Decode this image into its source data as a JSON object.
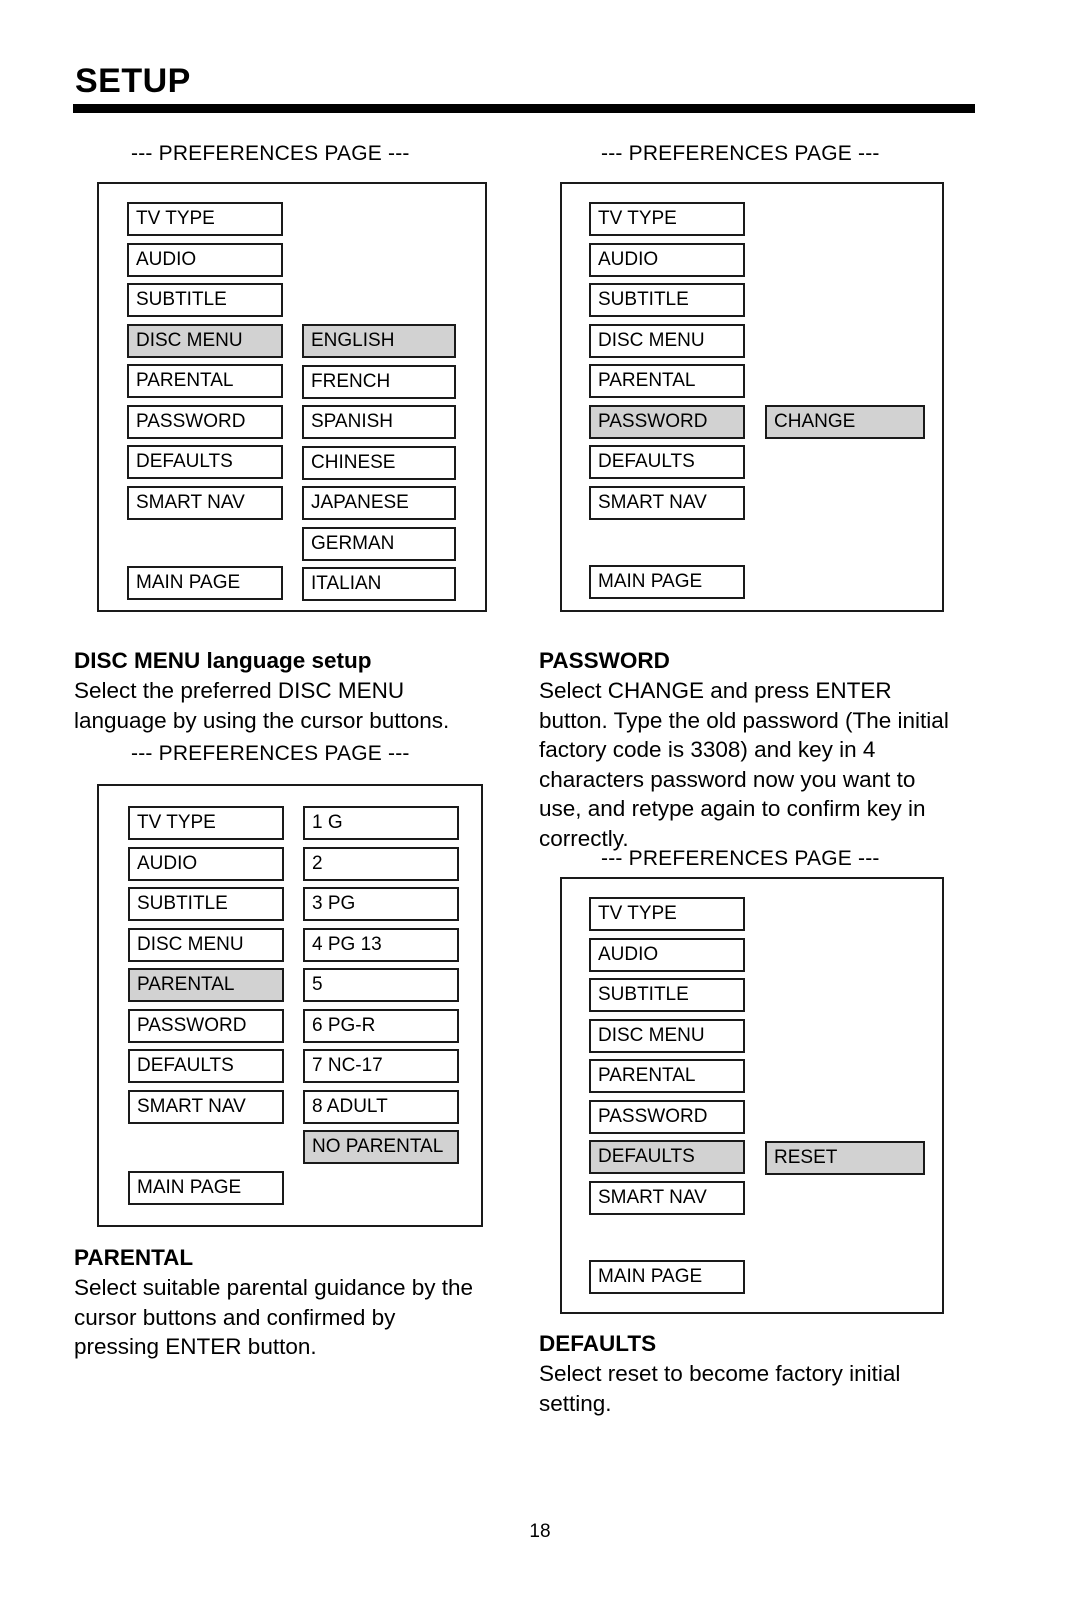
{
  "document": {
    "title": "SETUP",
    "page_number": "18"
  },
  "panels": [
    {
      "caption": "--- PREFERENCES PAGE ---",
      "menu": [
        {
          "label": "TV TYPE",
          "selected": false
        },
        {
          "label": "AUDIO",
          "selected": false
        },
        {
          "label": "SUBTITLE",
          "selected": false
        },
        {
          "label": "DISC MENU",
          "selected": true
        },
        {
          "label": "PARENTAL",
          "selected": false
        },
        {
          "label": "PASSWORD",
          "selected": false
        },
        {
          "label": "DEFAULTS",
          "selected": false
        },
        {
          "label": "SMART NAV",
          "selected": false
        }
      ],
      "main_page": "MAIN PAGE",
      "submenu": [
        {
          "label": "ENGLISH",
          "selected": true
        },
        {
          "label": "FRENCH",
          "selected": false
        },
        {
          "label": "SPANISH",
          "selected": false
        },
        {
          "label": "CHINESE",
          "selected": false
        },
        {
          "label": "JAPANESE",
          "selected": false
        },
        {
          "label": "GERMAN",
          "selected": false
        },
        {
          "label": "ITALIAN",
          "selected": false
        }
      ]
    },
    {
      "caption": "--- PREFERENCES PAGE ---",
      "menu": [
        {
          "label": "TV TYPE",
          "selected": false
        },
        {
          "label": "AUDIO",
          "selected": false
        },
        {
          "label": "SUBTITLE",
          "selected": false
        },
        {
          "label": "DISC MENU",
          "selected": false
        },
        {
          "label": "PARENTAL",
          "selected": false
        },
        {
          "label": "PASSWORD",
          "selected": true
        },
        {
          "label": "DEFAULTS",
          "selected": false
        },
        {
          "label": "SMART NAV",
          "selected": false
        }
      ],
      "main_page": "MAIN PAGE",
      "submenu": [
        {
          "label": "CHANGE",
          "selected": true
        }
      ]
    },
    {
      "caption": "--- PREFERENCES PAGE ---",
      "menu": [
        {
          "label": "TV TYPE",
          "selected": false
        },
        {
          "label": "AUDIO",
          "selected": false
        },
        {
          "label": "SUBTITLE",
          "selected": false
        },
        {
          "label": "DISC MENU",
          "selected": false
        },
        {
          "label": "PARENTAL",
          "selected": true
        },
        {
          "label": "PASSWORD",
          "selected": false
        },
        {
          "label": "DEFAULTS",
          "selected": false
        },
        {
          "label": "SMART NAV",
          "selected": false
        }
      ],
      "main_page": "MAIN PAGE",
      "submenu": [
        {
          "label": "1 G",
          "selected": false
        },
        {
          "label": "2",
          "selected": false
        },
        {
          "label": "3 PG",
          "selected": false
        },
        {
          "label": "4 PG 13",
          "selected": false
        },
        {
          "label": "5",
          "selected": false
        },
        {
          "label": "6 PG-R",
          "selected": false
        },
        {
          "label": "7 NC-17",
          "selected": false
        },
        {
          "label": "8 ADULT",
          "selected": false
        },
        {
          "label": "NO PARENTAL",
          "selected": true
        }
      ]
    },
    {
      "caption": "--- PREFERENCES PAGE ---",
      "menu": [
        {
          "label": "TV TYPE",
          "selected": false
        },
        {
          "label": "AUDIO",
          "selected": false
        },
        {
          "label": "SUBTITLE",
          "selected": false
        },
        {
          "label": "DISC MENU",
          "selected": false
        },
        {
          "label": "PARENTAL",
          "selected": false
        },
        {
          "label": "PASSWORD",
          "selected": false
        },
        {
          "label": "DEFAULTS",
          "selected": true
        },
        {
          "label": "SMART NAV",
          "selected": false
        }
      ],
      "main_page": "MAIN PAGE",
      "submenu": [
        {
          "label": "RESET",
          "selected": true
        }
      ]
    }
  ],
  "sections": {
    "disc_menu": {
      "heading": "DISC MENU language setup",
      "body": "Select the preferred DISC MENU\nlanguage by using the cursor buttons."
    },
    "password": {
      "heading": "PASSWORD",
      "body": "Select CHANGE and press ENTER\nbutton.  Type the old password (The initial\nfactory code is 3308) and key in 4\ncharacters password now you want to\nuse, and retype again to confirm key in\ncorrectly."
    },
    "parental": {
      "heading": "PARENTAL",
      "body": "Select suitable parental guidance by the\ncursor buttons and confirmed by\npressing ENTER button."
    },
    "defaults": {
      "heading": "DEFAULTS",
      "body": "Select reset to become factory initial\nsetting."
    }
  }
}
